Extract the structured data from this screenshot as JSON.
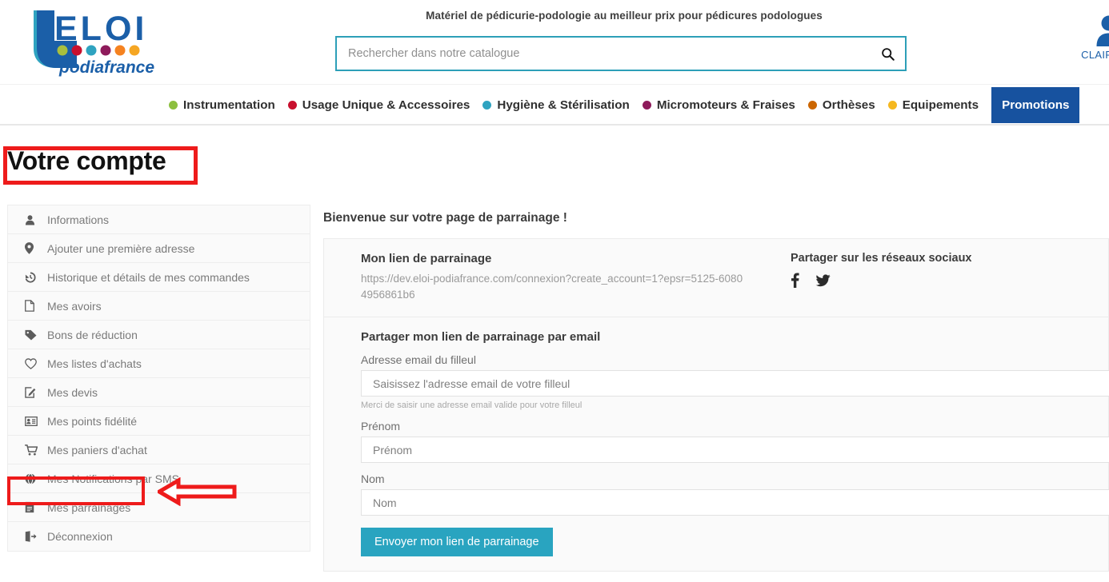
{
  "header": {
    "logo": {
      "brand_top": "ELOI",
      "brand_bottom": "podiafrance",
      "dot_colors": [
        "#a8bf3f",
        "#c8102e",
        "#2fa3c0",
        "#8e1b5b",
        "#f58220",
        "#f5a623"
      ]
    },
    "tagline": "Matériel de pédicurie-podologie au meilleur prix pour pédicures podologues",
    "search": {
      "placeholder": "Rechercher dans notre catalogue",
      "value": "",
      "icon": "search-icon",
      "border_color": "#2d9fb8"
    },
    "account": {
      "icon": "user-icon",
      "name": "CLAIRE TE",
      "color": "#1b5fa8"
    }
  },
  "nav": {
    "items": [
      {
        "label": "Instrumentation",
        "dot": "#8cbf3f"
      },
      {
        "label": "Usage Unique & Accessoires",
        "dot": "#c8102e"
      },
      {
        "label": "Hygiène & Stérilisation",
        "dot": "#2fa3c0"
      },
      {
        "label": "Micromoteurs & Fraises",
        "dot": "#8e1b5b"
      },
      {
        "label": "Orthèses",
        "dot": "#cc6600"
      },
      {
        "label": "Equipements",
        "dot": "#f5b820"
      }
    ],
    "promotions": {
      "label": "Promotions",
      "bg": "#17529f",
      "color": "#ffffff"
    }
  },
  "page": {
    "title": "Votre compte",
    "annotation_color": "#ee1b1b"
  },
  "sidebar": {
    "items": [
      {
        "label": "Informations",
        "icon": "user-icon"
      },
      {
        "label": "Ajouter une première adresse",
        "icon": "map-pin-icon"
      },
      {
        "label": "Historique et détails de mes commandes",
        "icon": "history-icon"
      },
      {
        "label": "Mes avoirs",
        "icon": "file-icon"
      },
      {
        "label": "Bons de réduction",
        "icon": "tag-icon"
      },
      {
        "label": "Mes listes d'achats",
        "icon": "heart-icon"
      },
      {
        "label": "Mes devis",
        "icon": "edit-square-icon"
      },
      {
        "label": "Mes points fidélité",
        "icon": "id-card-icon"
      },
      {
        "label": "Mes paniers d'achat",
        "icon": "shopping-cart-icon"
      },
      {
        "label": "Mes Notifications par SMS",
        "icon": "globe-icon"
      },
      {
        "label": "Mes parrainages",
        "icon": "document-icon"
      },
      {
        "label": "Déconnexion",
        "icon": "logout-icon"
      }
    ],
    "highlighted_item": "Mes parrainages"
  },
  "main": {
    "heading": "Bienvenue sur votre page de parrainage !",
    "referral": {
      "title": "Mon lien de parrainage",
      "url": "https://dev.eloi-podiafrance.com/connexion?create_account=1?epsr=5125-60804956861b6"
    },
    "social": {
      "title": "Partager sur les réseaux sociaux",
      "networks": [
        {
          "name": "facebook-icon"
        },
        {
          "name": "twitter-icon"
        }
      ]
    },
    "email_form": {
      "title": "Partager mon lien de parrainage par email",
      "fields": [
        {
          "label": "Adresse email du filleul",
          "placeholder": "Saisissez l'adresse email de votre filleul",
          "value": "",
          "hint": "Merci de saisir une adresse email valide pour votre filleul"
        },
        {
          "label": "Prénom",
          "placeholder": "Prénom",
          "value": "",
          "hint": ""
        },
        {
          "label": "Nom",
          "placeholder": "Nom",
          "value": "",
          "hint": ""
        }
      ],
      "submit_label": "Envoyer mon lien de parrainage",
      "submit_color": "#29a4c0"
    }
  }
}
